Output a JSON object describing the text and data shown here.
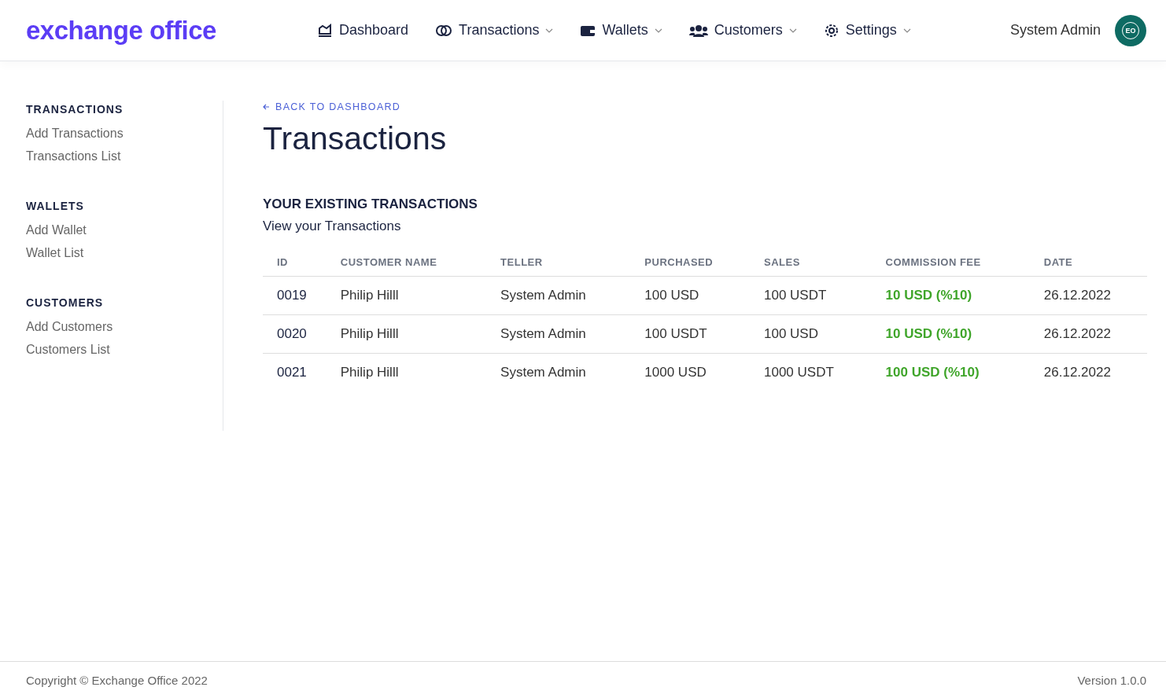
{
  "brand": "exchange office",
  "nav": [
    {
      "label": "Dashboard",
      "kind": "chart",
      "dropdown": false
    },
    {
      "label": "Transactions",
      "kind": "exchange",
      "dropdown": true
    },
    {
      "label": "Wallets",
      "kind": "wallet",
      "dropdown": true
    },
    {
      "label": "Customers",
      "kind": "users",
      "dropdown": true
    },
    {
      "label": "Settings",
      "kind": "gear",
      "dropdown": true
    }
  ],
  "user": {
    "name": "System Admin",
    "initials": "EO"
  },
  "sidebar": [
    {
      "heading": "TRANSACTIONS",
      "items": [
        "Add Transactions",
        "Transactions List"
      ]
    },
    {
      "heading": "WALLETS",
      "items": [
        "Add Wallet",
        "Wallet List"
      ]
    },
    {
      "heading": "CUSTOMERS",
      "items": [
        "Add Customers",
        "Customers List"
      ]
    }
  ],
  "back_link": "BACK TO DASHBOARD",
  "title": "Transactions",
  "section": {
    "heading": "YOUR EXISTING TRANSACTIONS",
    "subheading": "View your Transactions"
  },
  "table": {
    "columns": [
      "ID",
      "CUSTOMER NAME",
      "TELLER",
      "PURCHASED",
      "SALES",
      "COMMISSION FEE",
      "DATE"
    ],
    "rows": [
      [
        "0019",
        "Philip Hilll",
        "System Admin",
        "100 USD",
        "100 USDT",
        "10 USD (%10)",
        "26.12.2022"
      ],
      [
        "0020",
        "Philip Hilll",
        "System Admin",
        "100 USDT",
        "100 USD",
        "10 USD (%10)",
        "26.12.2022"
      ],
      [
        "0021",
        "Philip Hilll",
        "System Admin",
        "1000 USD",
        "1000 USDT",
        "100 USD (%10)",
        "26.12.2022"
      ]
    ]
  },
  "footer": {
    "copyright": "Copyright © Exchange Office 2022",
    "version": "Version 1.0.0"
  }
}
